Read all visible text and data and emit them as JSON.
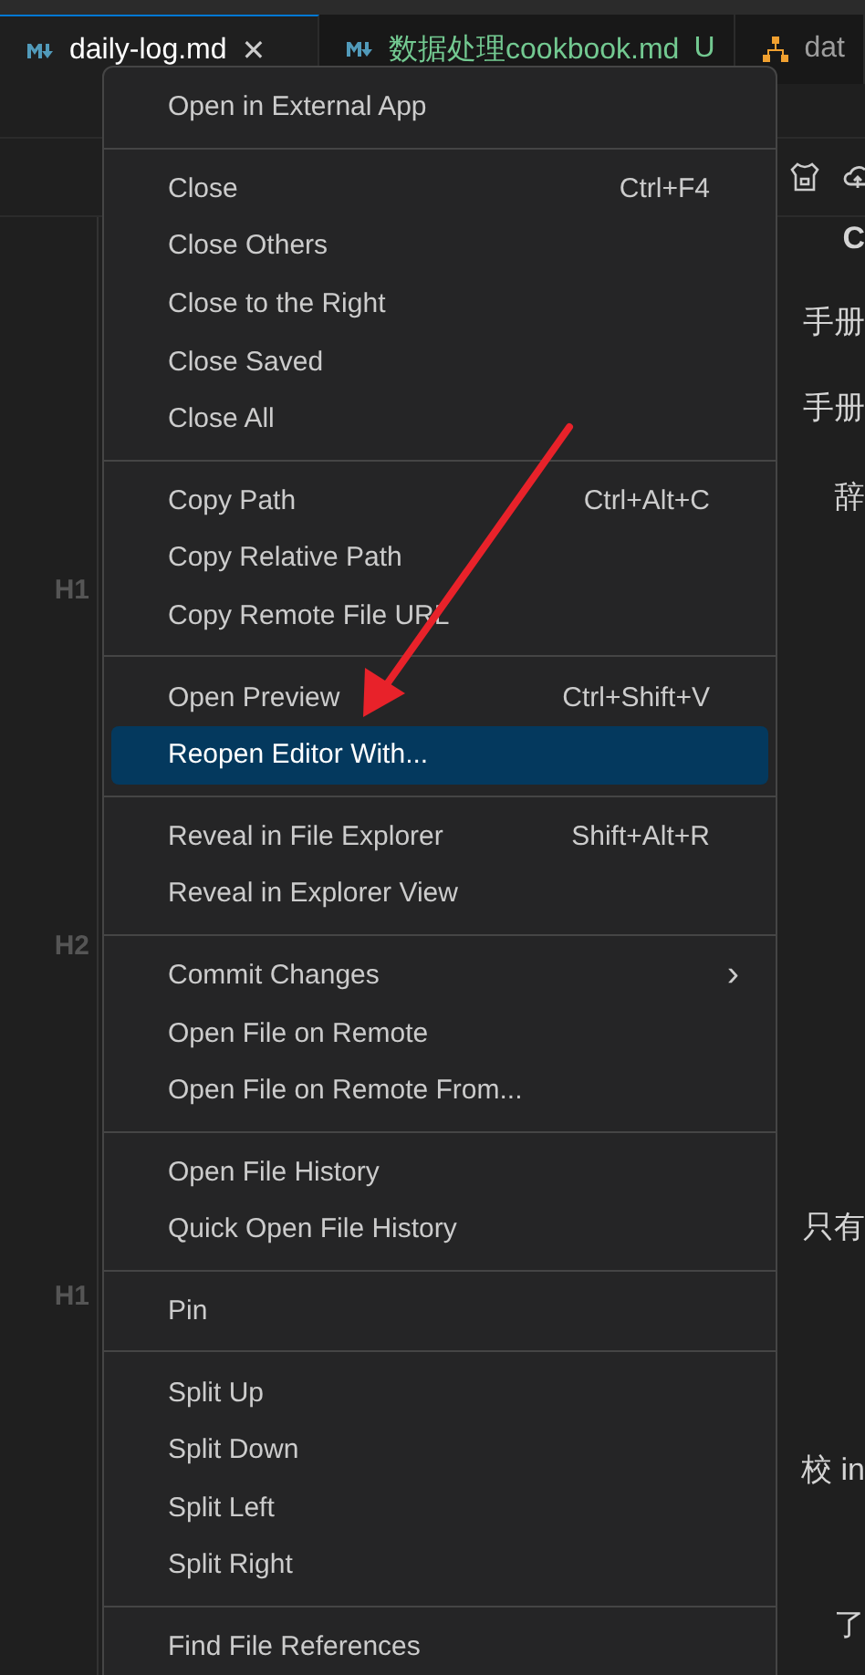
{
  "tabs": [
    {
      "label": "daily-log.md",
      "close": "✕",
      "selected": true
    },
    {
      "label": "数据处理cookbook.md",
      "status": "U",
      "selected": false
    },
    {
      "label": "dat",
      "selected": false
    }
  ],
  "gutter": [
    "H1",
    "H2",
    "H1"
  ],
  "editor_fragments": [
    "C",
    "手册",
    "手册",
    "辞",
    "只有",
    "校 in",
    "了"
  ],
  "context_menu": {
    "groups": [
      [
        {
          "label": "Open in External App",
          "selected": false
        }
      ],
      [
        {
          "label": "Close",
          "shortcut": "Ctrl+F4",
          "selected": false
        },
        {
          "label": "Close Others",
          "selected": false
        },
        {
          "label": "Close to the Right",
          "selected": false
        },
        {
          "label": "Close Saved",
          "selected": false
        },
        {
          "label": "Close All",
          "selected": false
        }
      ],
      [
        {
          "label": "Copy Path",
          "shortcut": "Ctrl+Alt+C",
          "selected": false
        },
        {
          "label": "Copy Relative Path",
          "selected": false
        },
        {
          "label": "Copy Remote File URL",
          "selected": false
        }
      ],
      [
        {
          "label": "Open Preview",
          "shortcut": "Ctrl+Shift+V",
          "selected": false
        },
        {
          "label": "Reopen Editor With...",
          "selected": true
        }
      ],
      [
        {
          "label": "Reveal in File Explorer",
          "shortcut": "Shift+Alt+R",
          "selected": false
        },
        {
          "label": "Reveal in Explorer View",
          "selected": false
        }
      ],
      [
        {
          "label": "Commit Changes",
          "submenu_arrow": "›",
          "selected": false
        },
        {
          "label": "Open File on Remote",
          "selected": false
        },
        {
          "label": "Open File on Remote From...",
          "selected": false
        }
      ],
      [
        {
          "label": "Open File History",
          "selected": false
        },
        {
          "label": "Quick Open File History",
          "selected": false
        }
      ],
      [
        {
          "label": "Pin",
          "selected": false
        }
      ],
      [
        {
          "label": "Split Up",
          "selected": false
        },
        {
          "label": "Split Down",
          "selected": false
        },
        {
          "label": "Split Left",
          "selected": false
        },
        {
          "label": "Split Right",
          "selected": false
        }
      ],
      [
        {
          "label": "Find File References",
          "selected": false
        }
      ]
    ]
  }
}
